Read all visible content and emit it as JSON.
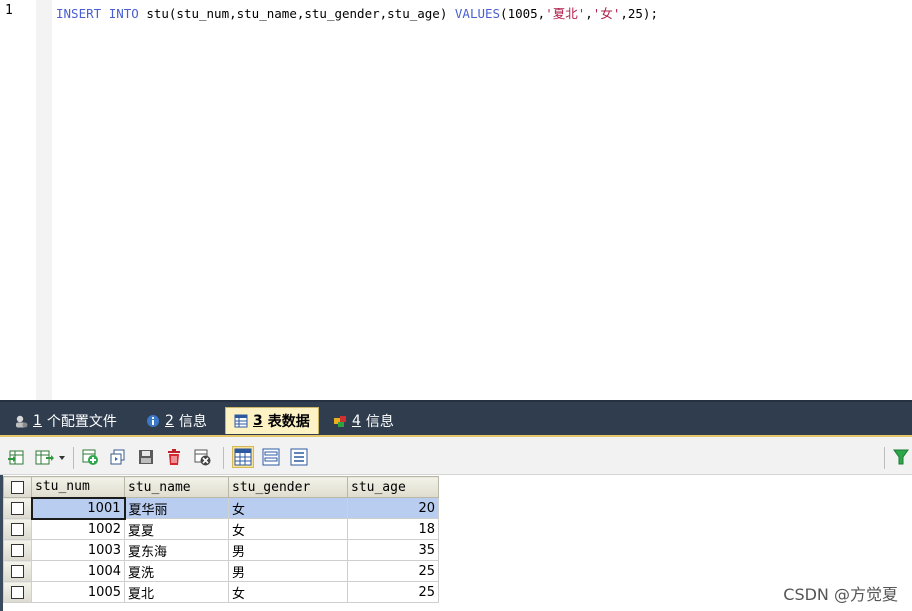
{
  "editor": {
    "line_number": "1",
    "sql": {
      "kw_insert": "INSERT",
      "kw_into": "INTO",
      "target": "stu(stu_num,stu_name,stu_gender,stu_age)",
      "kw_values": "VALUES",
      "open": "(1005,",
      "v_name": "'夏北'",
      "comma1": ",",
      "v_gender": "'女'",
      "close": ",25);"
    }
  },
  "tabs": [
    {
      "num": "1",
      "label": "个配置文件",
      "icon": "profile-icon"
    },
    {
      "num": "2",
      "label": "信息",
      "icon": "info-icon"
    },
    {
      "num": "3",
      "label": "表数据",
      "icon": "table-data-icon",
      "active": true
    },
    {
      "num": "4",
      "label": "信息",
      "icon": "info-colored-icon"
    }
  ],
  "grid": {
    "columns": [
      "stu_num",
      "stu_name",
      "stu_gender",
      "stu_age"
    ],
    "rows": [
      {
        "stu_num": "1001",
        "stu_name": "夏华丽",
        "stu_gender": "女",
        "stu_age": "20"
      },
      {
        "stu_num": "1002",
        "stu_name": "夏夏",
        "stu_gender": "女",
        "stu_age": "18"
      },
      {
        "stu_num": "1003",
        "stu_name": "夏东海",
        "stu_gender": "男",
        "stu_age": "35"
      },
      {
        "stu_num": "1004",
        "stu_name": "夏洗",
        "stu_gender": "男",
        "stu_age": "25"
      },
      {
        "stu_num": "1005",
        "stu_name": "夏北",
        "stu_gender": "女",
        "stu_age": "25"
      }
    ]
  },
  "watermark": "CSDN @方觉夏",
  "colors": {
    "keyword": "#4a5fd0",
    "string": "#b0204a",
    "tabbar": "#2f3d4f",
    "active_tab": "#fdf2c4",
    "selected_row": "#b9cdf0"
  }
}
